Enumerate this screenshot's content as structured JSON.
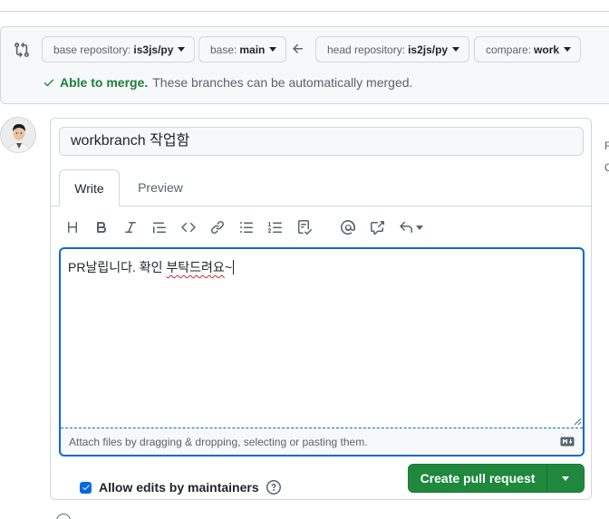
{
  "compare": {
    "base_repo_label": "base repository:",
    "base_repo_value": "is3js/py",
    "base_label": "base:",
    "base_value": "main",
    "head_repo_label": "head repository:",
    "head_repo_value": "is2js/py",
    "compare_label": "compare:",
    "compare_value": "work",
    "status_ok": "Able to merge.",
    "status_text": "These branches can be automatically merged."
  },
  "form": {
    "title_value": "workbranch 작업함",
    "tabs": [
      {
        "label": "Write",
        "active": true
      },
      {
        "label": "Preview",
        "active": false
      }
    ],
    "toolbar_icons": [
      "heading-icon",
      "bold-icon",
      "italic-icon",
      "quote-icon",
      "code-icon",
      "link-icon",
      "unordered-list-icon",
      "ordered-list-icon",
      "task-list-icon",
      "mention-icon",
      "cross-reference-icon",
      "saved-replies-icon"
    ],
    "body_plain": "PR날립니다. 확인 ",
    "body_misspelled": "부탁드려요",
    "body_tail": "~",
    "attach_text": "Attach files by dragging & dropping, selecting or pasting them.",
    "allow_edits_label": "Allow edits by maintainers",
    "allow_edits_checked": true,
    "create_button_label": "Create pull request"
  },
  "colors": {
    "accent": "#0969da",
    "success": "#1a7f37",
    "button_green": "#1f883d",
    "spellcheck": "#d1242f"
  }
}
